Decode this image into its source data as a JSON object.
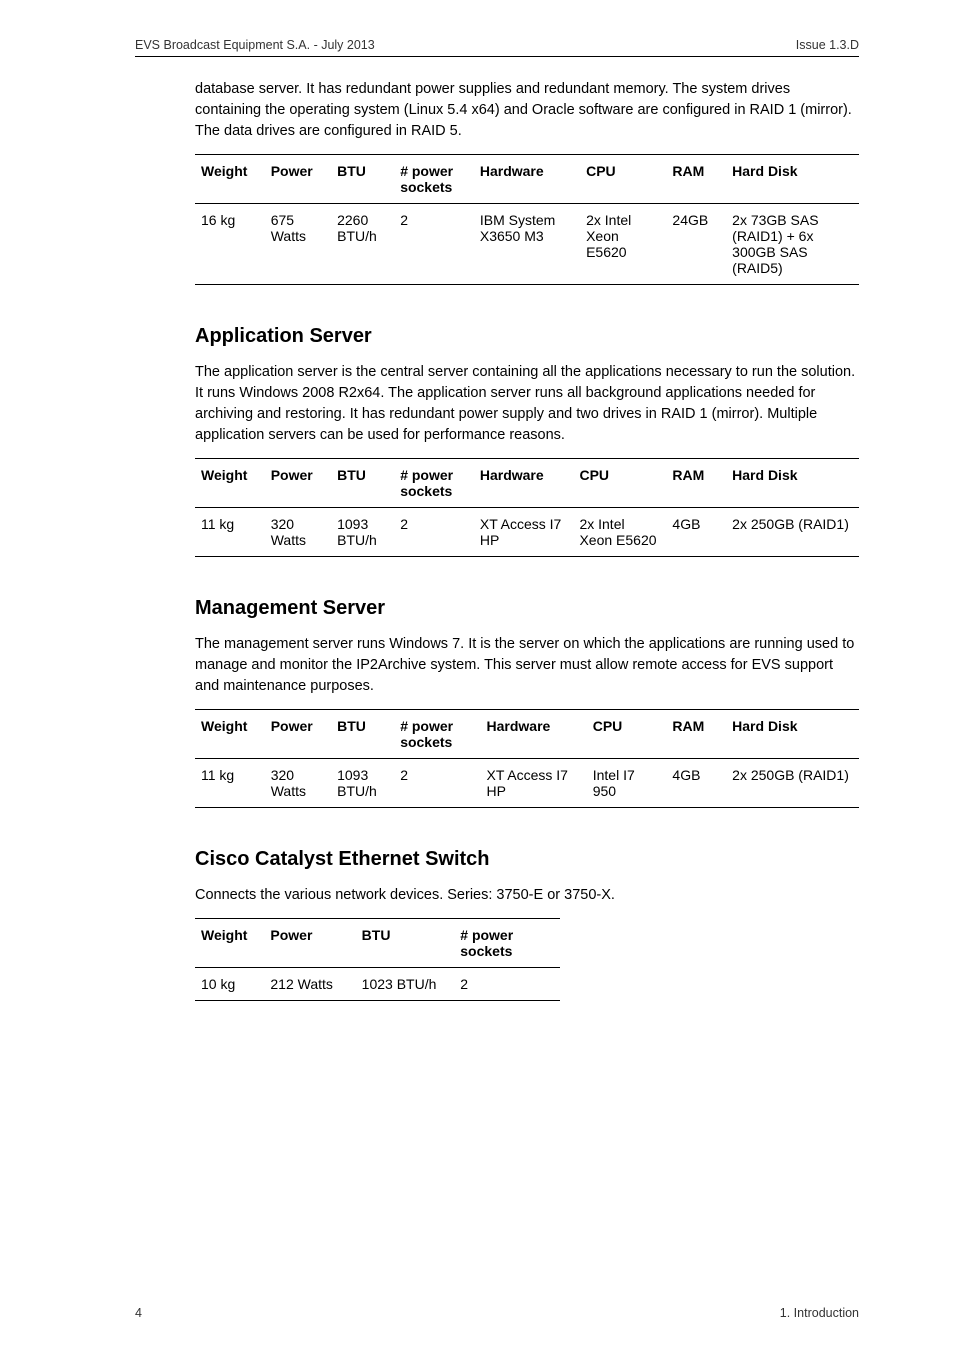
{
  "header": {
    "left": "EVS Broadcast Equipment S.A.  - July 2013",
    "right": "Issue 1.3.D"
  },
  "intro": {
    "para": "database server. It has redundant power supplies and redundant memory. The system drives containing the operating system (Linux 5.4 x64) and Oracle software are configured in RAID 1 (mirror). The data drives are configured in RAID 5."
  },
  "table1": {
    "headers": {
      "c1": "Weight",
      "c2": "Power",
      "c3": "BTU",
      "c4": "# power sockets",
      "c5": "Hardware",
      "c6": "CPU",
      "c7": "RAM",
      "c8": "Hard Disk"
    },
    "row": {
      "c1": "16 kg",
      "c2": "675 Watts",
      "c3": "2260 BTU/h",
      "c4": "2",
      "c5": "IBM System X3650 M3",
      "c6": "2x Intel Xeon E5620",
      "c7": "24GB",
      "c8": "2x 73GB SAS (RAID1) + 6x 300GB SAS (RAID5)"
    }
  },
  "app_server": {
    "title": "Application Server",
    "para": "The application server is the central server containing all the applications necessary to run the solution. It runs Windows 2008 R2x64. The application server runs all background applications needed for archiving and restoring. It has redundant power supply and two drives in RAID 1 (mirror). Multiple application servers can be used for performance reasons."
  },
  "table2": {
    "headers": {
      "c1": "Weight",
      "c2": "Power",
      "c3": "BTU",
      "c4": "# power sockets",
      "c5": "Hardware",
      "c6": "CPU",
      "c7": "RAM",
      "c8": "Hard Disk"
    },
    "row": {
      "c1": "11 kg",
      "c2": "320 Watts",
      "c3": "1093 BTU/h",
      "c4": "2",
      "c5": "XT Access I7 HP",
      "c6": "2x Intel Xeon E5620",
      "c7": "4GB",
      "c8": "2x 250GB (RAID1)"
    }
  },
  "mgmt_server": {
    "title": "Management Server",
    "para": "The management server runs Windows 7. It is the server on which the applications are running used to manage and monitor the IP2Archive system. This server must allow remote access for EVS support and maintenance purposes."
  },
  "table3": {
    "headers": {
      "c1": "Weight",
      "c2": "Power",
      "c3": "BTU",
      "c4": "# power sockets",
      "c5": "Hardware",
      "c6": "CPU",
      "c7": "RAM",
      "c8": "Hard Disk"
    },
    "row": {
      "c1": "11 kg",
      "c2": "320 Watts",
      "c3": "1093 BTU/h",
      "c4": "2",
      "c5": "XT Access I7 HP",
      "c6": "Intel I7 950",
      "c7": "4GB",
      "c8": "2x 250GB (RAID1)"
    }
  },
  "cisco": {
    "title": "Cisco Catalyst Ethernet Switch",
    "para": "Connects the various network devices. Series: 3750-E or 3750-X."
  },
  "table4": {
    "headers": {
      "c1": "Weight",
      "c2": "Power",
      "c3": "BTU",
      "c4": "# power sockets"
    },
    "row": {
      "c1": "10 kg",
      "c2": "212 Watts",
      "c3": "1023 BTU/h",
      "c4": "2"
    }
  },
  "footer": {
    "left": "4",
    "right": "1. Introduction"
  },
  "chart_data": [
    {
      "type": "table",
      "title": "Database Server Specs",
      "columns": [
        "Weight",
        "Power",
        "BTU",
        "# power sockets",
        "Hardware",
        "CPU",
        "RAM",
        "Hard Disk"
      ],
      "rows": [
        [
          "16 kg",
          "675 Watts",
          "2260 BTU/h",
          "2",
          "IBM System X3650 M3",
          "2x Intel Xeon E5620",
          "24GB",
          "2x 73GB SAS (RAID1) + 6x 300GB SAS (RAID5)"
        ]
      ]
    },
    {
      "type": "table",
      "title": "Application Server Specs",
      "columns": [
        "Weight",
        "Power",
        "BTU",
        "# power sockets",
        "Hardware",
        "CPU",
        "RAM",
        "Hard Disk"
      ],
      "rows": [
        [
          "11 kg",
          "320 Watts",
          "1093 BTU/h",
          "2",
          "XT Access I7 HP",
          "2x Intel Xeon E5620",
          "4GB",
          "2x 250GB (RAID1)"
        ]
      ]
    },
    {
      "type": "table",
      "title": "Management Server Specs",
      "columns": [
        "Weight",
        "Power",
        "BTU",
        "# power sockets",
        "Hardware",
        "CPU",
        "RAM",
        "Hard Disk"
      ],
      "rows": [
        [
          "11 kg",
          "320 Watts",
          "1093 BTU/h",
          "2",
          "XT Access I7 HP",
          "Intel I7 950",
          "4GB",
          "2x 250GB (RAID1)"
        ]
      ]
    },
    {
      "type": "table",
      "title": "Cisco Catalyst Ethernet Switch Specs",
      "columns": [
        "Weight",
        "Power",
        "BTU",
        "# power sockets"
      ],
      "rows": [
        [
          "10 kg",
          "212 Watts",
          "1023 BTU/h",
          "2"
        ]
      ]
    }
  ]
}
